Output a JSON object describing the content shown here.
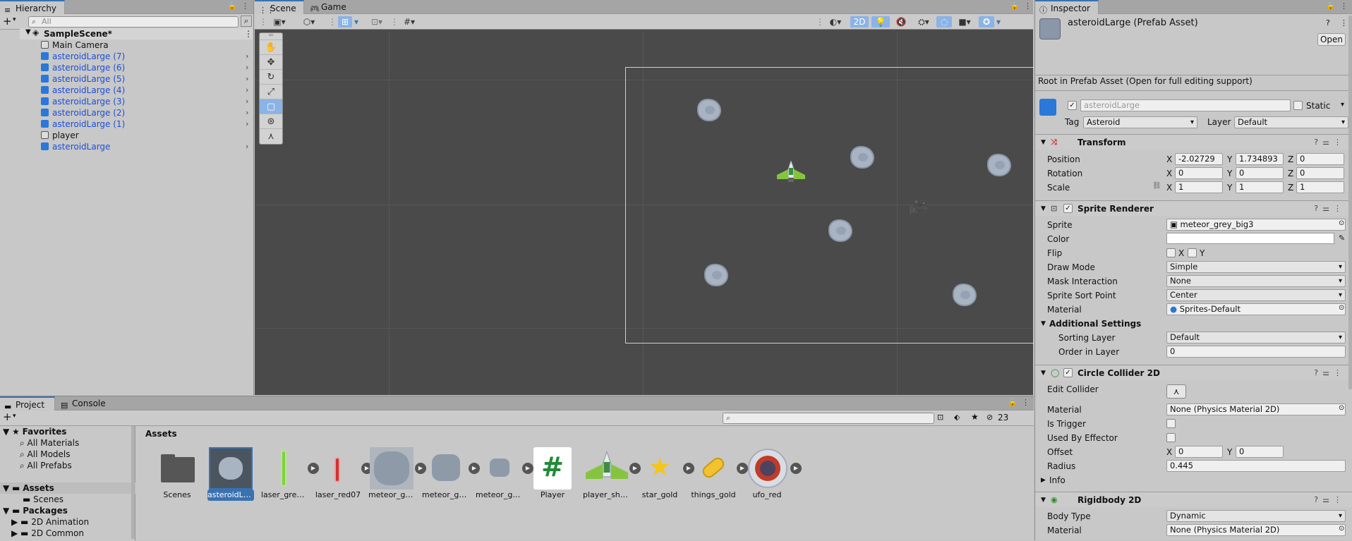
{
  "hierarchy": {
    "tab": "Hierarchy",
    "search_placeholder": "All",
    "scene_name": "SampleScene*",
    "items": [
      {
        "label": "Main Camera",
        "type": "grey"
      },
      {
        "label": "asteroidLarge (7)",
        "type": "prefab"
      },
      {
        "label": "asteroidLarge (6)",
        "type": "prefab"
      },
      {
        "label": "asteroidLarge (5)",
        "type": "prefab"
      },
      {
        "label": "asteroidLarge (4)",
        "type": "prefab"
      },
      {
        "label": "asteroidLarge (3)",
        "type": "prefab"
      },
      {
        "label": "asteroidLarge (2)",
        "type": "prefab"
      },
      {
        "label": "asteroidLarge (1)",
        "type": "prefab"
      },
      {
        "label": "player",
        "type": "grey"
      },
      {
        "label": "asteroidLarge",
        "type": "prefab"
      }
    ]
  },
  "scene": {
    "tabs": [
      "Scene",
      "Game"
    ],
    "toolbar": {
      "mode_2d": "2D"
    }
  },
  "inspector": {
    "tab": "Inspector",
    "asset_title": "asteroidLarge (Prefab Asset)",
    "open_label": "Open",
    "root_note": "Root in Prefab Asset (Open for full editing support)",
    "object_name": "asteroidLarge",
    "static_label": "Static",
    "tag_label": "Tag",
    "tag_value": "Asteroid",
    "layer_label": "Layer",
    "layer_value": "Default",
    "transform": {
      "title": "Transform",
      "position_label": "Position",
      "rotation_label": "Rotation",
      "scale_label": "Scale",
      "position": {
        "x": "-2.02729",
        "y": "1.734893",
        "z": "0"
      },
      "rotation": {
        "x": "0",
        "y": "0",
        "z": "0"
      },
      "scale": {
        "x": "1",
        "y": "1",
        "z": "1"
      },
      "axis_x": "X",
      "axis_y": "Y",
      "axis_z": "Z"
    },
    "sprite_renderer": {
      "title": "Sprite Renderer",
      "sprite_label": "Sprite",
      "sprite_value": "meteor_grey_big3",
      "color_label": "Color",
      "flip_label": "Flip",
      "flip_x": "X",
      "flip_y": "Y",
      "draw_mode_label": "Draw Mode",
      "draw_mode_value": "Simple",
      "mask_label": "Mask Interaction",
      "mask_value": "None",
      "sort_point_label": "Sprite Sort Point",
      "sort_point_value": "Center",
      "material_label": "Material",
      "material_value": "Sprites-Default",
      "additional_label": "Additional Settings",
      "sorting_layer_label": "Sorting Layer",
      "sorting_layer_value": "Default",
      "order_label": "Order in Layer",
      "order_value": "0"
    },
    "circle_collider": {
      "title": "Circle Collider 2D",
      "edit_label": "Edit Collider",
      "material_label": "Material",
      "material_value": "None (Physics Material 2D)",
      "trigger_label": "Is Trigger",
      "effector_label": "Used By Effector",
      "offset_label": "Offset",
      "offset_x": "0",
      "offset_y": "0",
      "radius_label": "Radius",
      "radius_value": "0.445",
      "info_label": "Info"
    },
    "rigidbody": {
      "title": "Rigidbody 2D",
      "body_type_label": "Body Type",
      "body_type_value": "Dynamic",
      "material_label": "Material",
      "material_value": "None (Physics Material 2D)"
    }
  },
  "project": {
    "tabs": [
      "Project",
      "Console"
    ],
    "hidden_count": "23",
    "favorites_label": "Favorites",
    "favorites": [
      "All Materials",
      "All Models",
      "All Prefabs"
    ],
    "assets_label": "Assets",
    "assets_children": [
      "Scenes"
    ],
    "packages_label": "Packages",
    "packages": [
      "2D Animation",
      "2D Common"
    ],
    "breadcrumb": "Assets",
    "grid": [
      "Scenes",
      "asteroidLa...",
      "laser_gree...",
      "laser_red07",
      "meteor_gr...",
      "meteor_gr...",
      "meteor_gr...",
      "Player",
      "player_shi...",
      "star_gold",
      "things_gold",
      "ufo_red"
    ]
  },
  "colors": {
    "selection": "#3a72b0",
    "prefab_blue": "#1d4fd8",
    "scene_bg": "#4a4a4a",
    "toggle_on": "#8ab3e6"
  },
  "icons": [
    "lock-icon",
    "menu-icon",
    "add-icon",
    "search-icon",
    "hand-icon",
    "move-icon",
    "rotate-icon",
    "scale-icon",
    "rect-icon",
    "transform-icon",
    "custom-tool-icon",
    "camera-gizmo-icon",
    "help-icon",
    "settings-icon"
  ]
}
